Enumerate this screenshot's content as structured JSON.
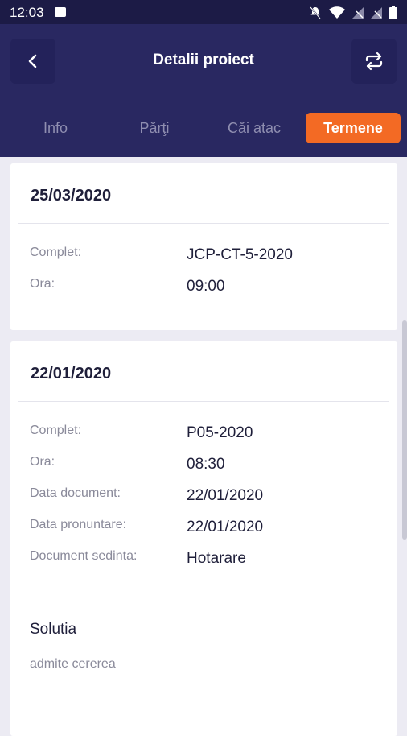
{
  "status_bar": {
    "time": "12:03"
  },
  "header": {
    "title": "Detalii proiect"
  },
  "tabs": [
    {
      "label": "Info"
    },
    {
      "label": "Părţi"
    },
    {
      "label": "Căi atac"
    },
    {
      "label": "Termene",
      "active": true
    }
  ],
  "hearings": [
    {
      "date": "25/03/2020",
      "fields": [
        {
          "label": "Complet:",
          "value": "JCP-CT-5-2020"
        },
        {
          "label": "Ora:",
          "value": "09:00"
        }
      ]
    },
    {
      "date": "22/01/2020",
      "fields": [
        {
          "label": "Complet:",
          "value": "P05-2020"
        },
        {
          "label": "Ora:",
          "value": "08:30"
        },
        {
          "label": "Data document:",
          "value": "22/01/2020"
        },
        {
          "label": "Data pronuntare:",
          "value": "22/01/2020"
        },
        {
          "label": "Document sedinta:",
          "value": "Hotarare"
        }
      ],
      "solution_title": "Solutia",
      "solution_text": "admite cererea"
    }
  ],
  "colors": {
    "header_bg": "#292861",
    "status_bg": "#1c1b46",
    "accent": "#f36a24",
    "page_bg": "#ecebf3"
  },
  "icons": [
    "image-icon",
    "notifications-off-icon",
    "wifi-icon",
    "no-signal-icon",
    "battery-icon",
    "back-arrow-icon",
    "refresh-icon"
  ]
}
